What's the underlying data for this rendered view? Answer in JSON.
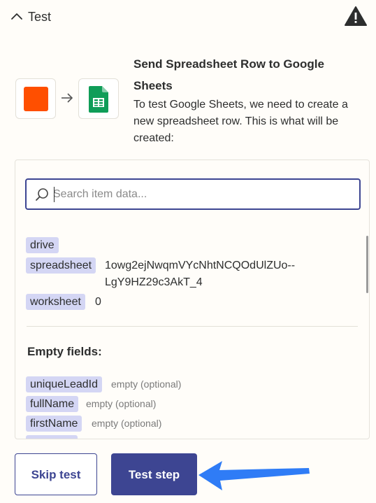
{
  "header": {
    "title": "Test",
    "warning_icon": "warning-icon"
  },
  "step": {
    "title": "Send Spreadsheet Row to Google Sheets",
    "description": "To test Google Sheets, we need to create a new spreadsheet row. This is what will be created:",
    "source_app_color": "#ff4f00",
    "target_app_icon": "google-sheets-icon"
  },
  "search": {
    "placeholder": "Search item data...",
    "value": ""
  },
  "fields": [
    {
      "key": "drive",
      "value": ""
    },
    {
      "key": "spreadsheet",
      "value_line1": "1owg2ejNwqmVYcNhtNCQOdUlZUo--",
      "value_line2": "LgY9HZ29c3AkT_4"
    },
    {
      "key": "worksheet",
      "value": "0"
    }
  ],
  "empty_fields": {
    "title": "Empty fields:",
    "items": [
      {
        "key": "uniqueLeadId",
        "hint": "empty (optional)"
      },
      {
        "key": "fullName",
        "hint": "empty (optional)"
      },
      {
        "key": "firstName",
        "hint": "empty (optional)"
      }
    ]
  },
  "buttons": {
    "skip": "Skip test",
    "test": "Test step"
  },
  "colors": {
    "accent": "#3d4592",
    "chip": "#d4d6f4",
    "pointer_arrow": "#2f7cf6",
    "background": "#fffdf9"
  }
}
